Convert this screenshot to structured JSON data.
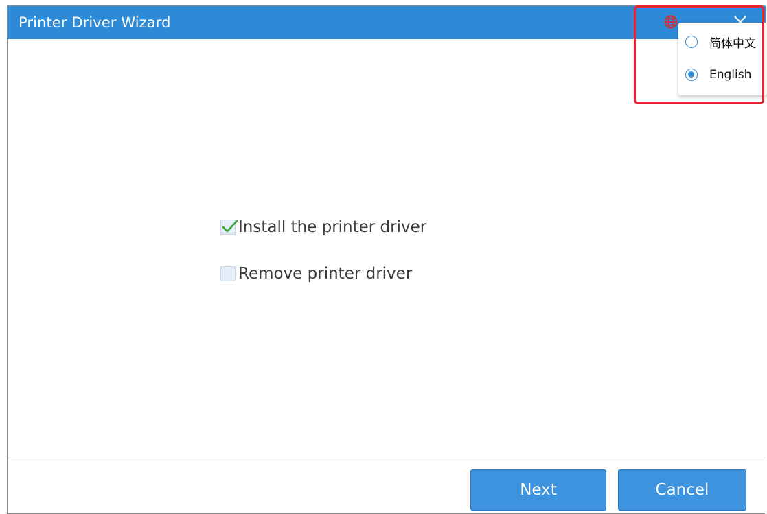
{
  "window": {
    "title": "Printer Driver Wizard"
  },
  "icons": {
    "language": "globe-icon",
    "close": "close-icon"
  },
  "options": [
    {
      "label": "Install the printer driver",
      "checked": true
    },
    {
      "label": "Remove printer driver",
      "checked": false
    }
  ],
  "buttons": {
    "next_label": "Next",
    "cancel_label": "Cancel"
  },
  "language_menu": {
    "items": [
      {
        "label": "简体中文",
        "selected": false
      },
      {
        "label": "English",
        "selected": true
      }
    ]
  },
  "colors": {
    "titlebar": "#2d8ad7",
    "button": "#3d93dd",
    "check": "#3aa63a",
    "globe": "#e0222a",
    "highlight": "#e8262c"
  }
}
